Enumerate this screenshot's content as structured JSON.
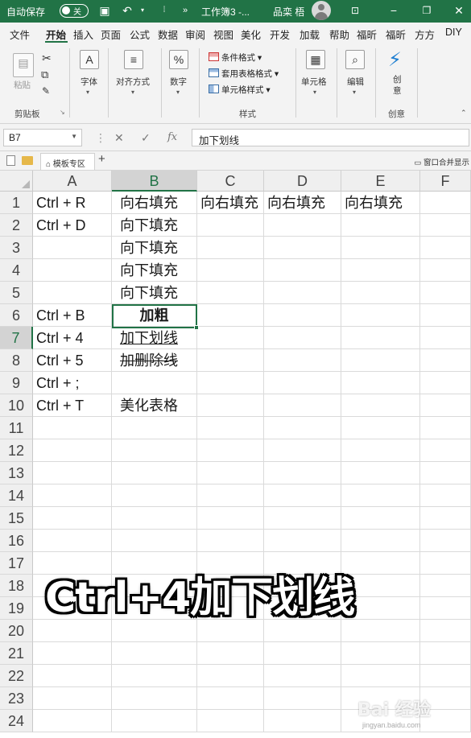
{
  "titlebar": {
    "autosave_label": "自动保存",
    "autosave_state": "关",
    "filename": "工作簿3 -...",
    "user": "品栾 梧",
    "bg_color": "#217346"
  },
  "tabs": [
    "文件",
    "开始",
    "插入",
    "页面",
    "公式",
    "数据",
    "审阅",
    "视图",
    "美化",
    "开发",
    "加载",
    "帮助",
    "福昕",
    "福昕",
    "方方",
    "DIY"
  ],
  "active_tab": "开始",
  "ribbon": {
    "clipboard": {
      "paste": "粘贴",
      "group": "剪贴板"
    },
    "font": {
      "label": "字体"
    },
    "align": {
      "label": "对齐方式"
    },
    "number": {
      "label": "数字",
      "icon_text": "%"
    },
    "styles": {
      "cond_format": "条件格式 ▾",
      "table_format": "套用表格格式 ▾",
      "cell_styles": "单元格样式 ▾",
      "group": "样式"
    },
    "cells": {
      "label": "单元格"
    },
    "editing": {
      "label": "编辑"
    },
    "create": {
      "label": "创意",
      "btn": "创\n意"
    }
  },
  "formula_bar": {
    "name_box": "B7",
    "cancel": "✕",
    "enter": "✓",
    "fx": "fx",
    "content": "加下划线"
  },
  "workbook_tabs": {
    "template_tab": "模板专区",
    "add": "+",
    "right_text": "窗口合并显示"
  },
  "sheet": {
    "columns": [
      "A",
      "B",
      "C",
      "D",
      "E",
      "F"
    ],
    "selected_column": "B",
    "selected_row": 7,
    "rows": [
      {
        "n": "1",
        "A": "Ctrl + R",
        "B": "向右填充",
        "C": "向右填充",
        "D": "向右填充",
        "E": "向右填充"
      },
      {
        "n": "2",
        "A": "Ctrl + D",
        "B": "向下填充",
        "C": "",
        "D": "",
        "E": ""
      },
      {
        "n": "3",
        "A": "",
        "B": "向下填充",
        "C": "",
        "D": "",
        "E": ""
      },
      {
        "n": "4",
        "A": "",
        "B": "向下填充",
        "C": "",
        "D": "",
        "E": ""
      },
      {
        "n": "5",
        "A": "",
        "B": "向下填充",
        "C": "",
        "D": "",
        "E": ""
      },
      {
        "n": "6",
        "A": "Ctrl + B",
        "B": "加粗",
        "C": "",
        "D": "",
        "E": ""
      },
      {
        "n": "7",
        "A": "Ctrl + 4",
        "B": "加下划线",
        "C": "",
        "D": "",
        "E": ""
      },
      {
        "n": "8",
        "A": "Ctrl + 5",
        "B": "加删除线",
        "C": "",
        "D": "",
        "E": ""
      },
      {
        "n": "9",
        "A": "Ctrl + ;",
        "B": "",
        "C": "",
        "D": "",
        "E": ""
      },
      {
        "n": "10",
        "A": "Ctrl + T",
        "B": "美化表格",
        "C": "",
        "D": "",
        "E": ""
      },
      {
        "n": "11"
      },
      {
        "n": "12"
      },
      {
        "n": "13"
      },
      {
        "n": "14"
      },
      {
        "n": "15"
      },
      {
        "n": "16"
      },
      {
        "n": "17"
      },
      {
        "n": "18"
      },
      {
        "n": "19"
      },
      {
        "n": "20"
      },
      {
        "n": "21"
      },
      {
        "n": "22"
      },
      {
        "n": "23"
      },
      {
        "n": "24"
      }
    ]
  },
  "caption": "Ctrl+4加下划线",
  "watermark": {
    "brand": "Bai 经验",
    "url": "jingyan.baidu.com"
  }
}
